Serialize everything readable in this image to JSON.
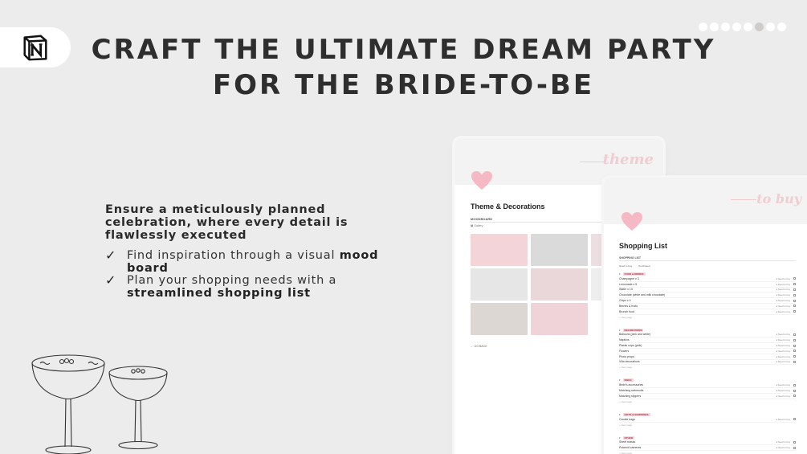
{
  "brand": {
    "logo_icon": "notion-logo-icon"
  },
  "carousel": {
    "count": 8,
    "active_index": 5
  },
  "headline": {
    "line1": "CRAFT THE ULTIMATE DREAM PARTY",
    "line2": "FOR THE BRIDE-TO-BE"
  },
  "intro": "Ensure a meticulously planned celebration, where every detail is flawlessly executed",
  "features": [
    {
      "text": "Find inspiration through a visual ",
      "bold": "mood board",
      "icon": "checkmark-icon"
    },
    {
      "text": "Plan your shopping needs with a ",
      "bold": "streamlined shopping list",
      "icon": "checkmark-icon"
    }
  ],
  "decor": {
    "glasses_icon": "cocktail-glasses-illustration"
  },
  "theme_card": {
    "script": "theme",
    "heart_icon": "heart-icon",
    "title": "Theme & Decorations",
    "section_label": "MOODBOARD",
    "view_label": "Gallery",
    "back_label": "GO BACK",
    "tile_colors": [
      "#f2d4d9",
      "#dadada",
      "#ecdfe1",
      "#e6e6e6",
      "#ead7da",
      "#eeeeee",
      "#dcd7d2",
      "#f0d3d9"
    ]
  },
  "shop_card": {
    "script": "to buy",
    "heart_icon": "heart-icon",
    "title": "Shopping List",
    "section_label": "SHOPPING LIST",
    "tabs": [
      "Need to buy",
      "Purchased"
    ],
    "status_label": "Need to buy",
    "new_page_label": "+ New page",
    "sections": [
      {
        "name": "FOOD & DRINKS",
        "items": [
          "Champagne x 3",
          "Lemonade x 5",
          "Water x 10",
          "Chocolate (white and milk chocolate)",
          "Chips x 4",
          "Berries & fruits",
          "Brunch food"
        ]
      },
      {
        "name": "DECORATIONS",
        "items": [
          "Balloons (pink and white)",
          "Napkins",
          "Plastic cups (pink)",
          "Flowers",
          "Photo props",
          "Villa decorations"
        ]
      },
      {
        "name": "SWAG",
        "items": [
          "Bride's accessories",
          "Matching swimsuits",
          "Matching slippers"
        ]
      },
      {
        "name": "GIFTS & SURPRISES",
        "items": [
          "Goodie bags"
        ]
      },
      {
        "name": "OTHER",
        "items": [
          "Sheet masks",
          "Polaroid cameras"
        ]
      }
    ]
  },
  "colors": {
    "background": "#ececec",
    "accent_pink": "#f1cdd3",
    "text_dark": "#2e2e2e"
  }
}
